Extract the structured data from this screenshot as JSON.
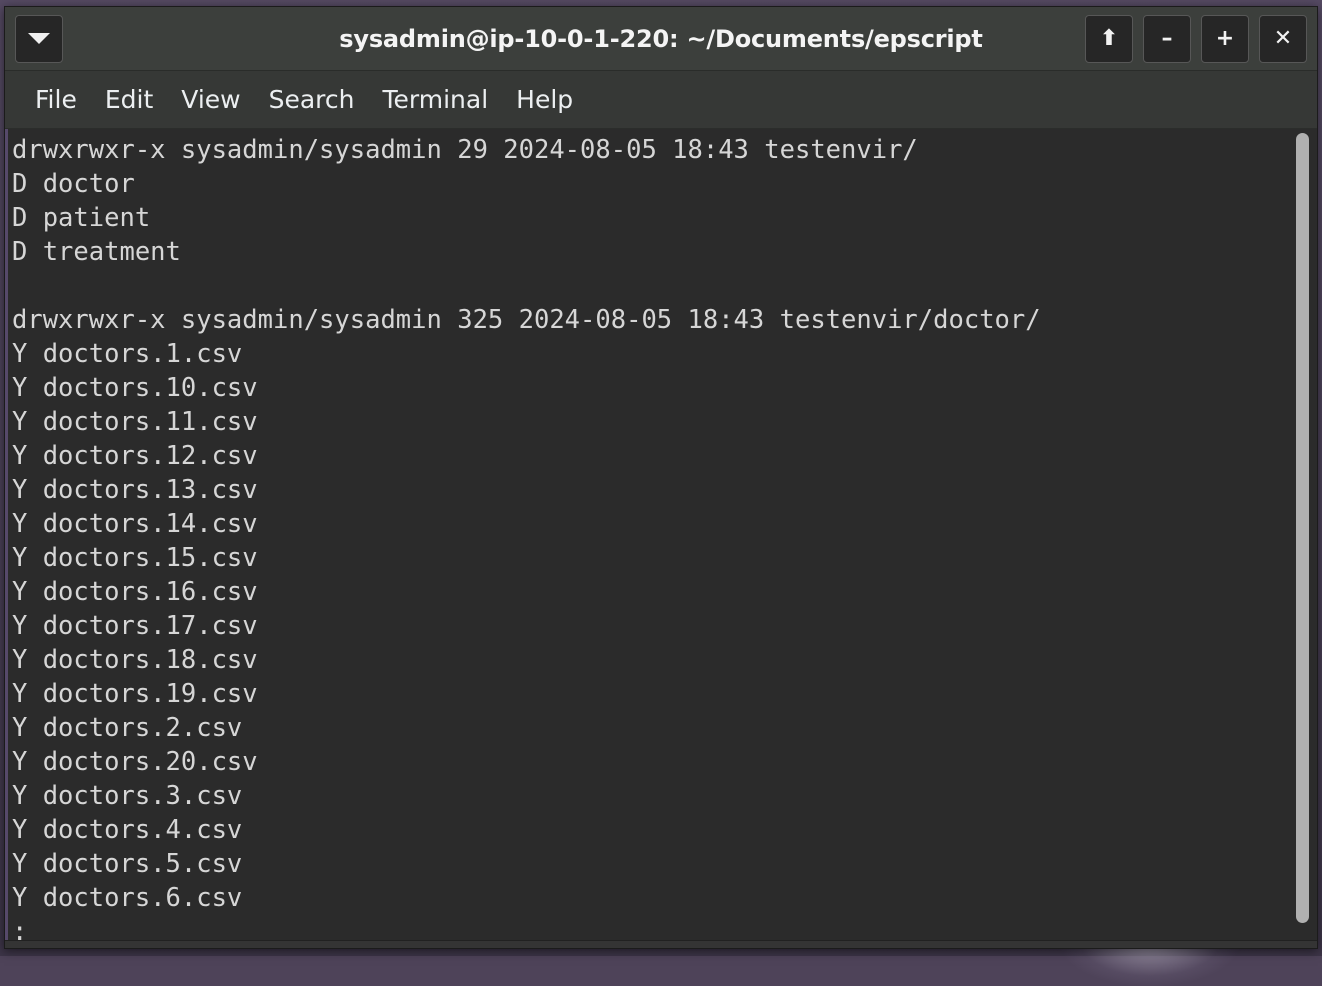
{
  "window": {
    "title": "sysadmin@ip-10-0-1-220: ~/Documents/epscript",
    "menu_button_icon": "chevron-down-icon",
    "controls": [
      {
        "name": "shade-button",
        "icon": "arrow-up-icon",
        "glyph": "⬆"
      },
      {
        "name": "minimize-button",
        "icon": "minus-icon",
        "glyph": "–"
      },
      {
        "name": "maximize-button",
        "icon": "plus-icon",
        "glyph": "+"
      },
      {
        "name": "close-button",
        "icon": "close-icon",
        "glyph": "✕"
      }
    ]
  },
  "menubar": {
    "items": [
      {
        "label": "File"
      },
      {
        "label": "Edit"
      },
      {
        "label": "View"
      },
      {
        "label": "Search"
      },
      {
        "label": "Terminal"
      },
      {
        "label": "Help"
      }
    ]
  },
  "terminal": {
    "background": "#2b2b2b",
    "foreground": "#d6d6d6",
    "lines": [
      "drwxrwxr-x sysadmin/sysadmin 29 2024-08-05 18:43 testenvir/",
      "D doctor",
      "D patient",
      "D treatment",
      "",
      "drwxrwxr-x sysadmin/sysadmin 325 2024-08-05 18:43 testenvir/doctor/",
      "Y doctors.1.csv",
      "Y doctors.10.csv",
      "Y doctors.11.csv",
      "Y doctors.12.csv",
      "Y doctors.13.csv",
      "Y doctors.14.csv",
      "Y doctors.15.csv",
      "Y doctors.16.csv",
      "Y doctors.17.csv",
      "Y doctors.18.csv",
      "Y doctors.19.csv",
      "Y doctors.2.csv",
      "Y doctors.20.csv",
      "Y doctors.3.csv",
      "Y doctors.4.csv",
      "Y doctors.5.csv",
      "Y doctors.6.csv",
      ":"
    ]
  },
  "scrollbar": {
    "name": "vertical-scrollbar",
    "thumb_color": "#b0b0b0"
  },
  "colors": {
    "desktop": "#4e4359",
    "titlebar": "#3c3f3c",
    "menubar": "#363836",
    "accent_border": "#56496a"
  }
}
